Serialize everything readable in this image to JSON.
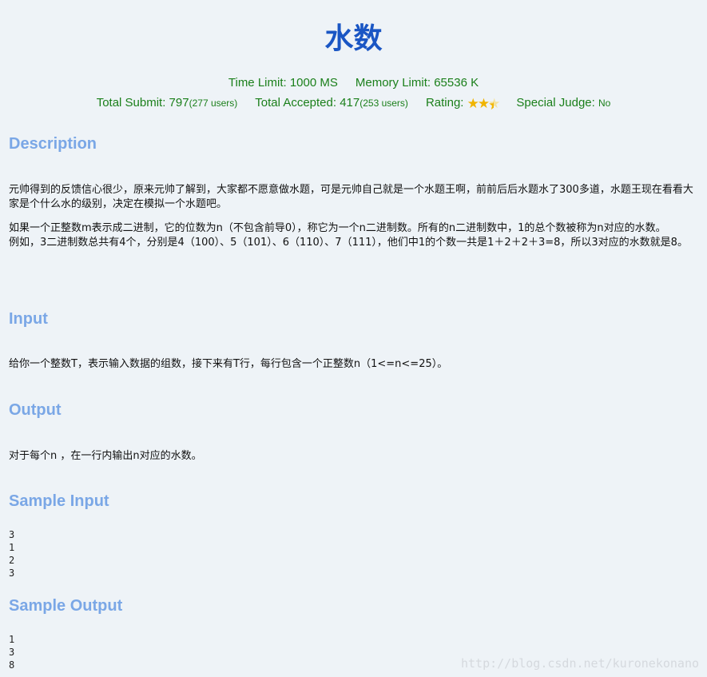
{
  "problem": {
    "title": "水数",
    "time_limit": "Time Limit: 1000 MS",
    "memory_limit": "Memory Limit: 65536 K",
    "total_submit_label": "Total Submit: 797",
    "total_submit_users": "(277 users)",
    "total_accepted_label": "Total Accepted: 417",
    "total_accepted_users": "(253 users)",
    "rating_label": "Rating:",
    "rating_stars": 2.5,
    "special_judge_label": "Special Judge:",
    "special_judge_value": "No"
  },
  "sections": {
    "description_title": "Description",
    "description_p1": "元帅得到的反馈信心很少，原来元帅了解到，大家都不愿意做水题，可是元帅自己就是一个水题王啊，前前后后水题水了300多道，水题王现在看看大家是个什么水的级别，决定在模拟一个水题吧。",
    "description_p2": "如果一个正整数m表示成二进制，它的位数为n（不包含前导0），称它为一个n二进制数。所有的n二进制数中，1的总个数被称为n对应的水数。",
    "description_p3": "例如，3二进制数总共有4个，分别是4（100）、5（101）、6（110）、7（111），他们中1的个数一共是1＋2＋2＋3=8，所以3对应的水数就是8。",
    "input_title": "Input",
    "input_text": "给你一个整数T，表示输入数据的组数，接下来有T行，每行包含一个正整数n（1<=n<=25）。",
    "output_title": "Output",
    "output_text": "对于每个n ，在一行内输出n对应的水数。",
    "sample_input_title": "Sample Input",
    "sample_input_lines": [
      "3",
      "1",
      "2",
      "3"
    ],
    "sample_output_title": "Sample Output",
    "sample_output_lines": [
      "1",
      "3",
      "8"
    ]
  },
  "watermark": "http://blog.csdn.net/kuronekonano"
}
